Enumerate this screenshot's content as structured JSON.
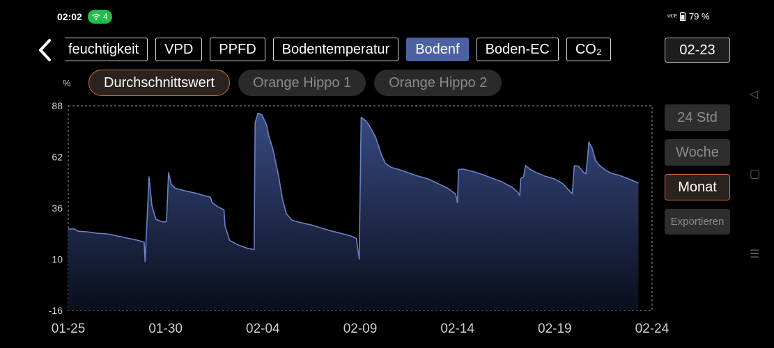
{
  "status": {
    "time": "02:02",
    "wifi_count": "4",
    "signal": "⁵ᴳᴸᵀᴱ",
    "battery": "79 %"
  },
  "tabs": [
    {
      "label": "feuchtigkeit",
      "active": false
    },
    {
      "label": "VPD",
      "active": false
    },
    {
      "label": "PPFD",
      "active": false
    },
    {
      "label": "Bodentemperatur",
      "active": false
    },
    {
      "label": "Bodenf",
      "active": true
    },
    {
      "label": "Boden-EC",
      "active": false
    },
    {
      "label": "CO₂",
      "active": false
    }
  ],
  "date_button": "02-23",
  "unit": "%",
  "device_pills": [
    {
      "label": "Durchschnittswert",
      "active": true
    },
    {
      "label": "Orange Hippo 1",
      "active": false
    },
    {
      "label": "Orange Hippo 2",
      "active": false
    }
  ],
  "range_buttons": [
    {
      "label": "24 Std",
      "active": false
    },
    {
      "label": "Woche",
      "active": false
    },
    {
      "label": "Monat",
      "active": true
    },
    {
      "label": "Exportieren",
      "active": false
    }
  ],
  "colors": {
    "accent": "#4c62a3",
    "active_border": "#d36a3c",
    "line": "#6b82c8"
  },
  "chart_data": {
    "type": "area",
    "ylabel": "%",
    "ylim": [
      -16,
      88
    ],
    "yticks": [
      88,
      62,
      36,
      10,
      -16
    ],
    "xlim": [
      0,
      30
    ],
    "xticks": [
      {
        "v": 0,
        "label": "01-25"
      },
      {
        "v": 5,
        "label": "01-30"
      },
      {
        "v": 10,
        "label": "02-04"
      },
      {
        "v": 15,
        "label": "02-09"
      },
      {
        "v": 20,
        "label": "02-14"
      },
      {
        "v": 25,
        "label": "02-19"
      },
      {
        "v": 30,
        "label": "02-24"
      }
    ],
    "series": [
      {
        "points": [
          [
            0,
            25.4
          ],
          [
            0.3,
            25.4
          ],
          [
            0.5,
            24.3
          ],
          [
            1,
            23.9
          ],
          [
            1.5,
            23.2
          ],
          [
            2,
            22.9
          ],
          [
            2.5,
            21.9
          ],
          [
            3,
            20.8
          ],
          [
            3.5,
            19.8
          ],
          [
            3.9,
            18.7
          ],
          [
            3.95,
            8.8
          ],
          [
            4.05,
            30.3
          ],
          [
            4.15,
            51.9
          ],
          [
            4.3,
            37.2
          ],
          [
            4.5,
            30.3
          ],
          [
            4.8,
            29.1
          ],
          [
            5,
            29.0
          ],
          [
            5.05,
            29.4
          ],
          [
            5.15,
            54.0
          ],
          [
            5.3,
            47.9
          ],
          [
            5.5,
            46.1
          ],
          [
            6,
            44.8
          ],
          [
            6.5,
            43.7
          ],
          [
            7,
            42.3
          ],
          [
            7.3,
            41.6
          ],
          [
            7.4,
            38.7
          ],
          [
            7.7,
            36.6
          ],
          [
            8.0,
            35.1
          ],
          [
            8.05,
            27.1
          ],
          [
            8.3,
            19.5
          ],
          [
            8.7,
            17.4
          ],
          [
            9.2,
            15.6
          ],
          [
            9.55,
            14.9
          ],
          [
            9.6,
            79.5
          ],
          [
            9.75,
            84.2
          ],
          [
            9.95,
            83.5
          ],
          [
            10.2,
            78.1
          ],
          [
            10.3,
            72.8
          ],
          [
            10.5,
            66.6
          ],
          [
            10.8,
            52.7
          ],
          [
            11.0,
            40.8
          ],
          [
            11.2,
            33.2
          ],
          [
            11.5,
            29.8
          ],
          [
            12,
            28.5
          ],
          [
            12.5,
            27.4
          ],
          [
            13,
            25.9
          ],
          [
            13.5,
            24.4
          ],
          [
            14,
            23.2
          ],
          [
            14.5,
            21.9
          ],
          [
            14.8,
            20.6
          ],
          [
            14.95,
            10.1
          ],
          [
            15.05,
            82.1
          ],
          [
            15.3,
            80.3
          ],
          [
            15.5,
            77.4
          ],
          [
            15.8,
            71.9
          ],
          [
            16.1,
            63.0
          ],
          [
            16.3,
            58.7
          ],
          [
            16.6,
            56.7
          ],
          [
            17,
            55.6
          ],
          [
            17.5,
            53.9
          ],
          [
            18,
            52.2
          ],
          [
            18.5,
            50.8
          ],
          [
            19,
            48.4
          ],
          [
            19.5,
            46.1
          ],
          [
            19.9,
            43.1
          ],
          [
            20.0,
            38.7
          ],
          [
            20.05,
            55.6
          ],
          [
            20.3,
            55.8
          ],
          [
            20.8,
            54.6
          ],
          [
            21.3,
            53.0
          ],
          [
            21.8,
            51.1
          ],
          [
            22.3,
            49.3
          ],
          [
            22.8,
            46.6
          ],
          [
            23.1,
            44.1
          ],
          [
            23.2,
            42.3
          ],
          [
            23.25,
            51.1
          ],
          [
            23.4,
            51.9
          ],
          [
            23.5,
            57.7
          ],
          [
            23.7,
            55.9
          ],
          [
            24,
            54.3
          ],
          [
            24.5,
            52.2
          ],
          [
            25,
            50.8
          ],
          [
            25.4,
            48.5
          ],
          [
            25.9,
            43.3
          ],
          [
            26.0,
            57.5
          ],
          [
            26.2,
            57.4
          ],
          [
            26.5,
            54.0
          ],
          [
            26.6,
            53.5
          ],
          [
            26.7,
            63.1
          ],
          [
            26.75,
            69.6
          ],
          [
            26.9,
            66.9
          ],
          [
            27.1,
            60.3
          ],
          [
            27.3,
            57.7
          ],
          [
            27.6,
            55.3
          ],
          [
            27.9,
            53.7
          ],
          [
            28.3,
            52.7
          ],
          [
            28.7,
            51.2
          ],
          [
            29.0,
            50.0
          ],
          [
            29.3,
            48.7
          ]
        ]
      }
    ]
  }
}
